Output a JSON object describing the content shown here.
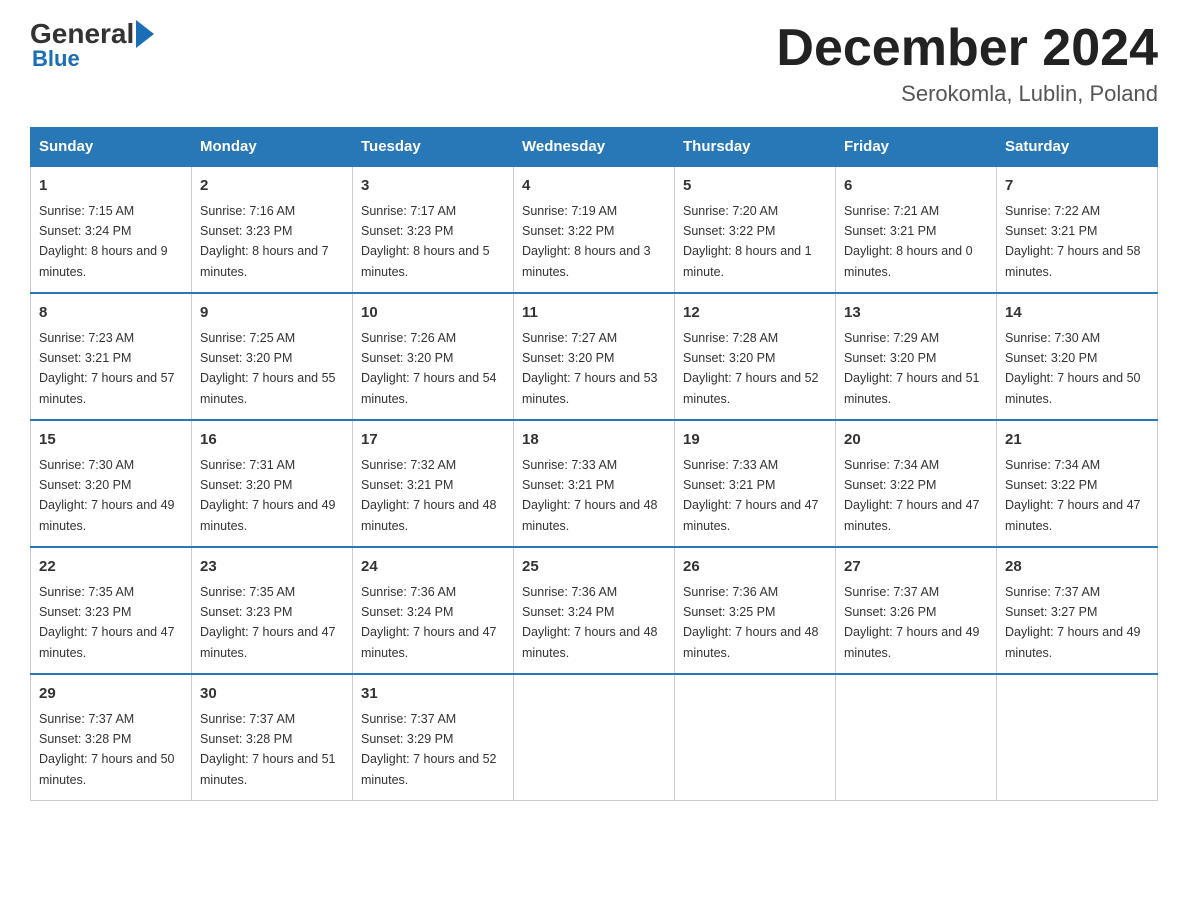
{
  "logo": {
    "general": "General",
    "blue": "Blue"
  },
  "header": {
    "month_year": "December 2024",
    "location": "Serokomla, Lublin, Poland"
  },
  "columns": [
    "Sunday",
    "Monday",
    "Tuesday",
    "Wednesday",
    "Thursday",
    "Friday",
    "Saturday"
  ],
  "weeks": [
    [
      {
        "day": "1",
        "sunrise": "7:15 AM",
        "sunset": "3:24 PM",
        "daylight": "8 hours and 9 minutes."
      },
      {
        "day": "2",
        "sunrise": "7:16 AM",
        "sunset": "3:23 PM",
        "daylight": "8 hours and 7 minutes."
      },
      {
        "day": "3",
        "sunrise": "7:17 AM",
        "sunset": "3:23 PM",
        "daylight": "8 hours and 5 minutes."
      },
      {
        "day": "4",
        "sunrise": "7:19 AM",
        "sunset": "3:22 PM",
        "daylight": "8 hours and 3 minutes."
      },
      {
        "day": "5",
        "sunrise": "7:20 AM",
        "sunset": "3:22 PM",
        "daylight": "8 hours and 1 minute."
      },
      {
        "day": "6",
        "sunrise": "7:21 AM",
        "sunset": "3:21 PM",
        "daylight": "8 hours and 0 minutes."
      },
      {
        "day": "7",
        "sunrise": "7:22 AM",
        "sunset": "3:21 PM",
        "daylight": "7 hours and 58 minutes."
      }
    ],
    [
      {
        "day": "8",
        "sunrise": "7:23 AM",
        "sunset": "3:21 PM",
        "daylight": "7 hours and 57 minutes."
      },
      {
        "day": "9",
        "sunrise": "7:25 AM",
        "sunset": "3:20 PM",
        "daylight": "7 hours and 55 minutes."
      },
      {
        "day": "10",
        "sunrise": "7:26 AM",
        "sunset": "3:20 PM",
        "daylight": "7 hours and 54 minutes."
      },
      {
        "day": "11",
        "sunrise": "7:27 AM",
        "sunset": "3:20 PM",
        "daylight": "7 hours and 53 minutes."
      },
      {
        "day": "12",
        "sunrise": "7:28 AM",
        "sunset": "3:20 PM",
        "daylight": "7 hours and 52 minutes."
      },
      {
        "day": "13",
        "sunrise": "7:29 AM",
        "sunset": "3:20 PM",
        "daylight": "7 hours and 51 minutes."
      },
      {
        "day": "14",
        "sunrise": "7:30 AM",
        "sunset": "3:20 PM",
        "daylight": "7 hours and 50 minutes."
      }
    ],
    [
      {
        "day": "15",
        "sunrise": "7:30 AM",
        "sunset": "3:20 PM",
        "daylight": "7 hours and 49 minutes."
      },
      {
        "day": "16",
        "sunrise": "7:31 AM",
        "sunset": "3:20 PM",
        "daylight": "7 hours and 49 minutes."
      },
      {
        "day": "17",
        "sunrise": "7:32 AM",
        "sunset": "3:21 PM",
        "daylight": "7 hours and 48 minutes."
      },
      {
        "day": "18",
        "sunrise": "7:33 AM",
        "sunset": "3:21 PM",
        "daylight": "7 hours and 48 minutes."
      },
      {
        "day": "19",
        "sunrise": "7:33 AM",
        "sunset": "3:21 PM",
        "daylight": "7 hours and 47 minutes."
      },
      {
        "day": "20",
        "sunrise": "7:34 AM",
        "sunset": "3:22 PM",
        "daylight": "7 hours and 47 minutes."
      },
      {
        "day": "21",
        "sunrise": "7:34 AM",
        "sunset": "3:22 PM",
        "daylight": "7 hours and 47 minutes."
      }
    ],
    [
      {
        "day": "22",
        "sunrise": "7:35 AM",
        "sunset": "3:23 PM",
        "daylight": "7 hours and 47 minutes."
      },
      {
        "day": "23",
        "sunrise": "7:35 AM",
        "sunset": "3:23 PM",
        "daylight": "7 hours and 47 minutes."
      },
      {
        "day": "24",
        "sunrise": "7:36 AM",
        "sunset": "3:24 PM",
        "daylight": "7 hours and 47 minutes."
      },
      {
        "day": "25",
        "sunrise": "7:36 AM",
        "sunset": "3:24 PM",
        "daylight": "7 hours and 48 minutes."
      },
      {
        "day": "26",
        "sunrise": "7:36 AM",
        "sunset": "3:25 PM",
        "daylight": "7 hours and 48 minutes."
      },
      {
        "day": "27",
        "sunrise": "7:37 AM",
        "sunset": "3:26 PM",
        "daylight": "7 hours and 49 minutes."
      },
      {
        "day": "28",
        "sunrise": "7:37 AM",
        "sunset": "3:27 PM",
        "daylight": "7 hours and 49 minutes."
      }
    ],
    [
      {
        "day": "29",
        "sunrise": "7:37 AM",
        "sunset": "3:28 PM",
        "daylight": "7 hours and 50 minutes."
      },
      {
        "day": "30",
        "sunrise": "7:37 AM",
        "sunset": "3:28 PM",
        "daylight": "7 hours and 51 minutes."
      },
      {
        "day": "31",
        "sunrise": "7:37 AM",
        "sunset": "3:29 PM",
        "daylight": "7 hours and 52 minutes."
      },
      null,
      null,
      null,
      null
    ]
  ]
}
